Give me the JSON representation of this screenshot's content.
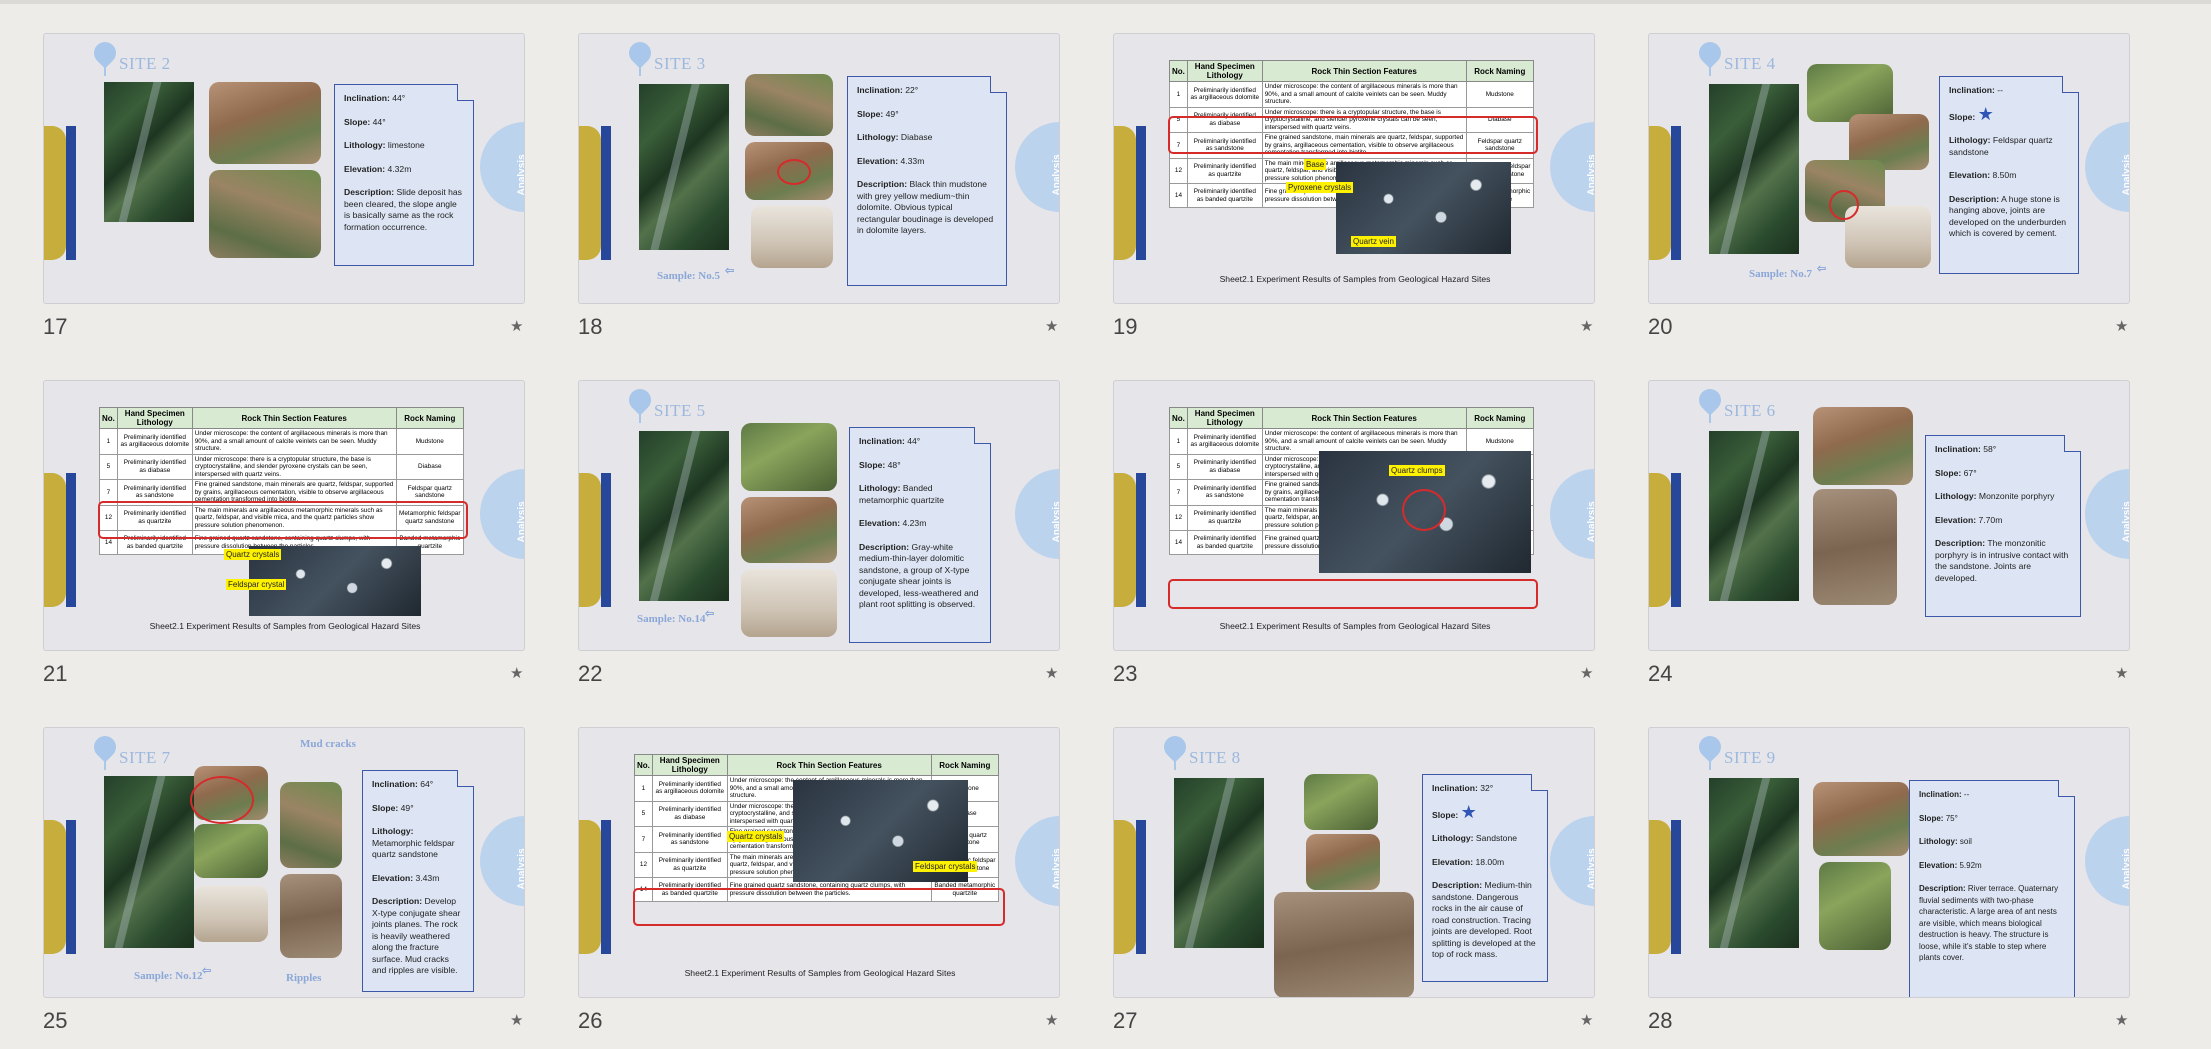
{
  "slides": [
    {
      "n": "17",
      "site": "SITE 2",
      "card": [
        [
          "Inclination:",
          "44°"
        ],
        [
          "Slope:",
          "44°"
        ],
        [
          "Lithology:",
          "limestone"
        ],
        [
          "Elevation:",
          "4.32m"
        ],
        [
          "Description:",
          "Slide deposit has been cleared, the slope angle is basically same as the rock formation occurrence."
        ]
      ]
    },
    {
      "n": "18",
      "site": "SITE 3",
      "sample": "Sample: No.5",
      "card": [
        [
          "Inclination:",
          "22°"
        ],
        [
          "Slope:",
          "49°"
        ],
        [
          "Lithology:",
          "Diabase"
        ],
        [
          "Elevation:",
          "4.33m"
        ],
        [
          "Description:",
          "Black thin mudstone with grey yellow medium~thin dolomite. Obvious typical rectangular boudinage is developed in dolomite layers."
        ]
      ]
    },
    {
      "n": "19",
      "caption": "Sheet2.1  Experiment Results of Samples from Geological Hazard Sites",
      "tags": [
        "Base",
        "Pyroxene crystals",
        "Quartz vein"
      ]
    },
    {
      "n": "20",
      "site": "SITE 4",
      "sample": "Sample: No.7",
      "card": [
        [
          "Inclination:",
          "--"
        ],
        [
          "Slope:",
          "★"
        ],
        [
          "Lithology:",
          "Feldspar quartz sandstone"
        ],
        [
          "Elevation:",
          "8.50m"
        ],
        [
          "Description:",
          "A huge stone is hanging above, joints are developed on the underburden which is covered by cement."
        ]
      ]
    },
    {
      "n": "21",
      "caption": "Sheet2.1  Experiment Results of Samples from Geological Hazard Sites",
      "tags": [
        "Quartz crystals",
        "Feldspar crystal"
      ]
    },
    {
      "n": "22",
      "site": "SITE 5",
      "sample": "Sample: No.14",
      "card": [
        [
          "Inclination:",
          "44°"
        ],
        [
          "Slope:",
          "48°"
        ],
        [
          "Lithology:",
          "Banded metamorphic quartzite"
        ],
        [
          "Elevation:",
          "4.23m"
        ],
        [
          "Description:",
          "Gray-white medium-thin-layer dolomitic sandstone, a group of X-type conjugate shear joints is developed, less-weathered and plant root splitting is observed."
        ]
      ]
    },
    {
      "n": "23",
      "caption": "Sheet2.1  Experiment Results of Samples from Geological Hazard Sites",
      "tags": [
        "Quartz clumps"
      ]
    },
    {
      "n": "24",
      "site": "SITE 6",
      "card": [
        [
          "Inclination:",
          "58°"
        ],
        [
          "Slope:",
          "67°"
        ],
        [
          "Lithology:",
          "Monzonite porphyry"
        ],
        [
          "Elevation:",
          "7.70m"
        ],
        [
          "Description:",
          "The monzonitic porphyry is in intrusive contact with the sandstone. Joints are developed."
        ]
      ]
    },
    {
      "n": "25",
      "site": "SITE 7",
      "sample": "Sample: No.12",
      "mud": "Mud cracks",
      "ripples": "Ripples",
      "card": [
        [
          "Inclination:",
          "64°"
        ],
        [
          "Slope:",
          "49°"
        ],
        [
          "Lithology:",
          "Metamorphic feldspar quartz sandstone"
        ],
        [
          "Elevation:",
          "3.43m"
        ],
        [
          "Description:",
          "Develop X-type conjugate shear joints planes. The rock is heavily weathered along the fracture surface. Mud cracks and ripples are visible."
        ]
      ]
    },
    {
      "n": "26",
      "caption": "Sheet2.1  Experiment Results of Samples from Geological Hazard Sites",
      "tags": [
        "Quartz crystals",
        "Feldspar crystals"
      ]
    },
    {
      "n": "27",
      "site": "SITE 8",
      "card": [
        [
          "Inclination:",
          "32°"
        ],
        [
          "Slope:",
          "★"
        ],
        [
          "Lithology:",
          "Sandstone"
        ],
        [
          "Elevation:",
          "18.00m"
        ],
        [
          "Description:",
          "Medium-thin sandstone. Dangerous rocks in the air cause of road construction. Tracing joints are developed. Root splitting is developed at the top of rock mass."
        ]
      ]
    },
    {
      "n": "28",
      "site": "SITE 9",
      "card": [
        [
          "Inclination:",
          "--"
        ],
        [
          "Slope:",
          "75°"
        ],
        [
          "Lithology:",
          "soil"
        ],
        [
          "Elevation:",
          "5.92m"
        ],
        [
          "Description:",
          "River terrace. Quaternary fluvial sediments with two-phase characteristic. A large area of ant nests are visible, which means biological destruction is heavy. The structure is loose, while it's stable to step where plants cover."
        ]
      ]
    }
  ],
  "analysis_label": "Analysis",
  "table": {
    "headers": [
      "No.",
      "Hand Specimen Lithology",
      "Rock Thin Section Features",
      "Rock Naming"
    ],
    "rows": [
      [
        "1",
        "Preliminarily identified as argillaceous dolomite",
        "Under microscope: the content of argillaceous minerals is more than 90%, and a small amount of calcite veinlets can be seen. Muddy structure.",
        "Mudstone"
      ],
      [
        "5",
        "Preliminarily identified as diabase",
        "Under microscope: there is a cryptopular structure, the base is cryptocrystalline, and slender pyroxene crystals can be seen, interspersed with quartz veins.",
        "Diabase"
      ],
      [
        "7",
        "Preliminarily identified as sandstone",
        "Fine grained sandstone, main minerals are quartz, feldspar, supported by grains, argillaceous cementation, visible to observe argillaceous cementation transformed into biotite.",
        "Feldspar quartz sandstone"
      ],
      [
        "12",
        "Preliminarily identified as quartzite",
        "The main minerals are argillaceous metamorphic minerals such as quartz, feldspar, and visible mica, and the quartz particles show pressure solution phenomenon.",
        "Metamorphic feldspar quartz sandstone"
      ],
      [
        "14",
        "Preliminarily identified as banded quartzite",
        "Fine grained quartz sandstone, containing quartz clumps, with pressure dissolution between the particles.",
        "Banded metamorphic quartzite"
      ]
    ]
  }
}
